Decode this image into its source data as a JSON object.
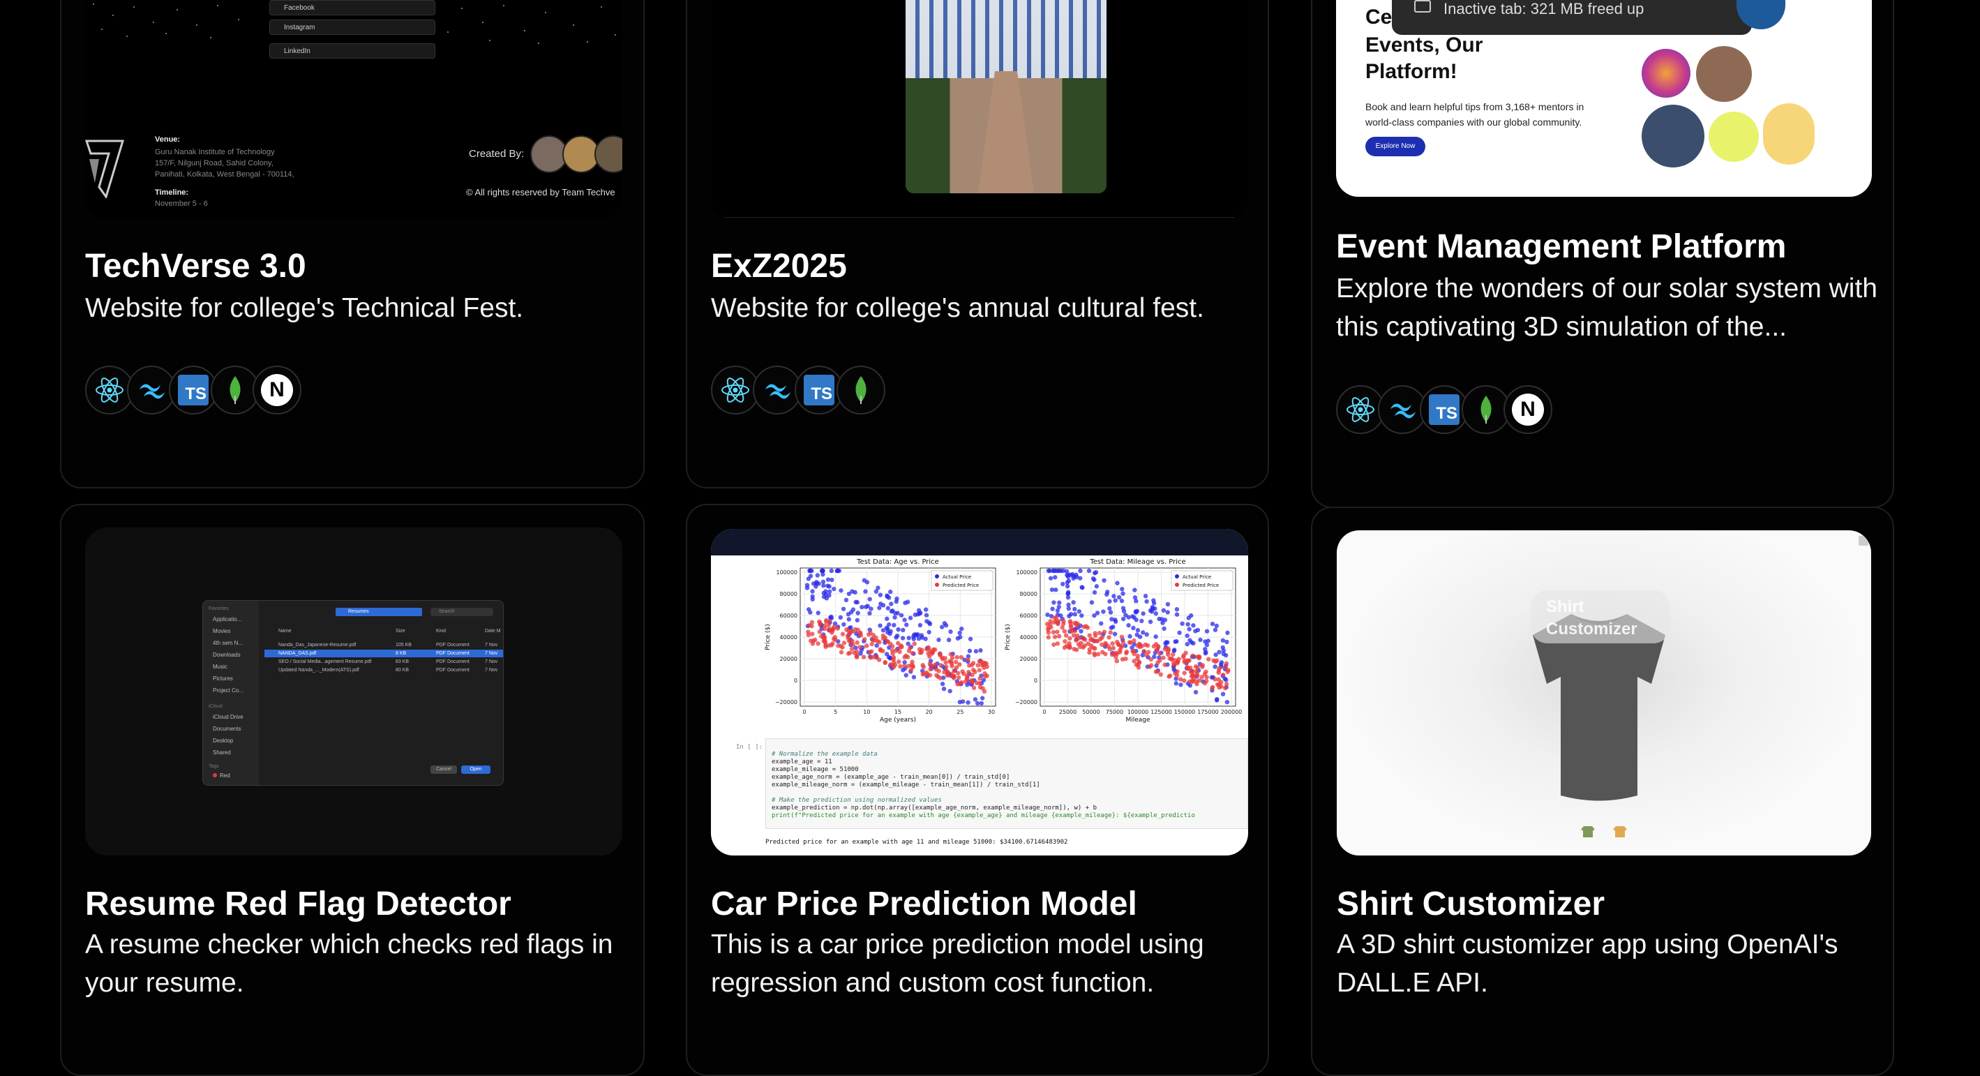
{
  "projects": [
    {
      "title": "TechVerse 3.0",
      "description": "Website for college's Technical Fest."
    },
    {
      "title": "ExZ2025",
      "description": "Website for college's annual cultural fest."
    },
    {
      "title": "Event Management Platform",
      "description": "Explore the wonders of our solar system with this captivating 3D simulation of the..."
    },
    {
      "title": "Resume Red Flag Detector",
      "description": "A resume checker which checks red flags in your resume."
    },
    {
      "title": "Car Price Prediction Model",
      "description": "This is a car price prediction model using regression and custom cost function."
    },
    {
      "title": "Shirt Customizer",
      "description": "A 3D shirt customizer app using OpenAI's DALL.E API."
    }
  ],
  "tech_icons": {
    "card1": [
      "react-icon",
      "tailwind-icon",
      "typescript-icon",
      "mongodb-icon",
      "nextjs-icon"
    ],
    "card2": [
      "react-icon",
      "tailwind-icon",
      "typescript-icon",
      "mongodb-icon"
    ],
    "card3": [
      "react-icon",
      "tailwind-icon",
      "typescript-icon",
      "mongodb-icon",
      "nextjs-icon"
    ]
  },
  "techverse_preview": {
    "links": [
      "Facebook",
      "Instagram",
      "LinkedIn"
    ],
    "venue_label": "Venue:",
    "venue_lines": [
      "Guru Nanak Institute of Technology",
      "157/F, Nilgunj Road, Sahid Colony,",
      "Panihati, Kolkata, West Bengal - 700114,"
    ],
    "timeline_label": "Timeline:",
    "timeline_value": "November 5 - 6",
    "created_by": "Created By:",
    "rights": "© All rights reserved by Team Techve"
  },
  "event_preview": {
    "tab_notice": "Inactive tab: 321 MB freed up",
    "heading_lines": [
      "Ce",
      "Events, Our",
      "Platform!"
    ],
    "subtext": "Book and learn helpful tips from 3,168+ mentors in world-class companies with our global community.",
    "button": "Explore Now"
  },
  "resume_preview": {
    "location": "Resumes",
    "search_placeholder": "Search",
    "sidebar_favorites": "Favorites",
    "sidebar_items": [
      "Applicatio...",
      "Movies",
      "4th sem N...",
      "Downloads",
      "Music",
      "Pictures",
      "Project Co..."
    ],
    "sidebar_icloud_label": "iCloud",
    "sidebar_icloud": [
      "iCloud Drive",
      "Documents",
      "Desktop",
      "Shared"
    ],
    "sidebar_tags_label": "Tags",
    "sidebar_tags": [
      "Red"
    ],
    "columns": [
      "Name",
      "Size",
      "Kind",
      "Date M"
    ],
    "files": [
      {
        "name": "Nanda_Das_Japanese-Resume.pdf",
        "size": "105 KB",
        "kind": "PDF Document",
        "date": "7 Nov"
      },
      {
        "name": "NANDA_DAS.pdf",
        "size": "8 KB",
        "kind": "PDF Document",
        "date": "7 Nov"
      },
      {
        "name": "SEO / Social Media...agement Resume.pdf",
        "size": "83 KB",
        "kind": "PDF Document",
        "date": "7 Nov"
      },
      {
        "name": "Updated Nanda_..._Modern(ATS).pdf",
        "size": "80 KB",
        "kind": "PDF Document",
        "date": "7 Nov"
      }
    ],
    "cancel": "Cancel",
    "open": "Open"
  },
  "car_preview": {
    "plot1_title": "Test Data: Age vs. Price",
    "plot1_xlabel": "Age (years)",
    "plot1_xticks": [
      "0",
      "5",
      "10",
      "15",
      "20",
      "25",
      "30"
    ],
    "plot2_title": "Test Data: Mileage vs. Price",
    "plot2_xlabel": "Mileage",
    "plot2_xticks": [
      "0",
      "25000",
      "50000",
      "75000",
      "100000",
      "125000",
      "150000",
      "175000",
      "200000"
    ],
    "ylabel": "Price ($)",
    "yticks": [
      "100000",
      "80000",
      "60000",
      "40000",
      "20000",
      "0",
      "−20000"
    ],
    "legend_actual": "Actual Price",
    "legend_predicted": "Predicted Price",
    "cell_prompt": "In [ ]:",
    "code_lines": [
      "# Normalize the example data",
      "example_age = 11",
      "example_mileage = 51000",
      "example_age_norm = (example_age - train_mean[0]) / train_std[0]",
      "example_mileage_norm = (example_mileage - train_mean[1]) / train_std[1]",
      "",
      "# Make the prediction using normalized values",
      "example_prediction = np.dot(np.array([example_age_norm, example_mileage_norm]), w) + b",
      "print(f\"Predicted price for an example with age {example_age} and mileage {example_mileage}: ${example_predictio"
    ],
    "output": "Predicted price for an example with age 11 and mileage 51000: $34100.67146483902"
  },
  "shirt_preview": {
    "overlay_text": "Shirt Customizer"
  },
  "colors": {
    "accent_blue": "#3178c6",
    "react": "#61dafb",
    "tailwind": "#38bdf8",
    "mongo": "#4db33d",
    "actual": "#2a2ae8",
    "predicted": "#e83a3a"
  }
}
